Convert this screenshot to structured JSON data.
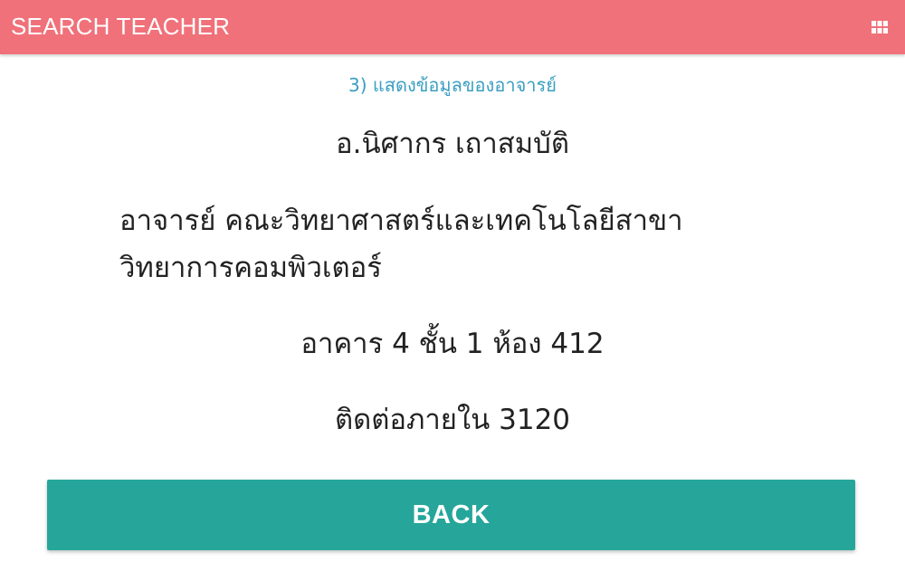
{
  "app_bar": {
    "title": "SEARCH TEACHER",
    "menu_icon": "grid-view-icon",
    "background_color": "#f0717a"
  },
  "step_label": "3) แสดงข้อมูลของอาจารย์",
  "teacher": {
    "name": "อ.นิศากร เถาสมบัติ",
    "position": "อาจารย์ คณะวิทยาศาสตร์และเทคโนโลยีสาขาวิทยาการคอมพิวเตอร์",
    "office": "อาคาร 4 ชั้น 1 ห้อง 412",
    "phone": "ติดต่อภายใน 3120"
  },
  "actions": {
    "back_label": "BACK",
    "back_color": "#26a69a"
  }
}
